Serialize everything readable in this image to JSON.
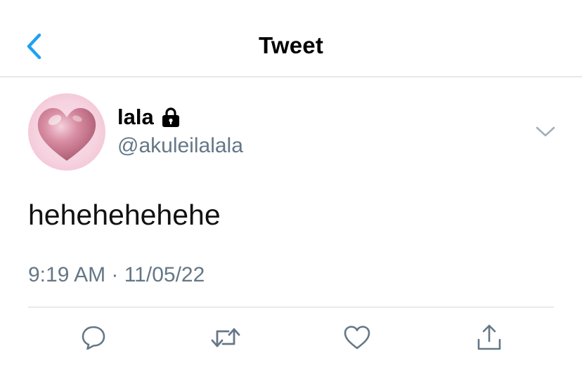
{
  "header": {
    "title": "Tweet",
    "back_icon": "chevron-left-icon",
    "accent_color": "#1da1f2"
  },
  "tweet": {
    "author": {
      "display_name": "lala",
      "handle": "@akuleilalala",
      "protected_icon": "lock-icon",
      "avatar": "pink-heart-avatar"
    },
    "text": "hehehehehehe",
    "timestamp": "9:19 AM · 11/05/22",
    "more_icon": "chevron-down-icon"
  },
  "actions": [
    {
      "name": "reply",
      "icon": "reply-icon"
    },
    {
      "name": "retweet",
      "icon": "retweet-icon"
    },
    {
      "name": "like",
      "icon": "heart-icon"
    },
    {
      "name": "share",
      "icon": "share-icon"
    }
  ],
  "colors": {
    "secondary_text": "#657786",
    "icon_gray": "#657786",
    "divider": "#d6d6d8"
  }
}
